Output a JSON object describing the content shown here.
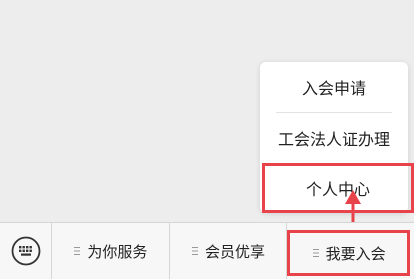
{
  "submenu": {
    "items": [
      {
        "label": "入会申请"
      },
      {
        "label": "工会法人证办理"
      },
      {
        "label": "个人中心"
      }
    ]
  },
  "menu": {
    "tabs": [
      {
        "label": "为你服务"
      },
      {
        "label": "会员优享"
      },
      {
        "label": "我要入会"
      }
    ]
  },
  "icons": {
    "keyboard": "keyboard-icon",
    "menu_lines": "menu-lines-icon",
    "arrow": "arrow-up-icon"
  },
  "colors": {
    "highlight": "#e8424a",
    "background": "#ededed",
    "bar": "#f7f7f7"
  }
}
